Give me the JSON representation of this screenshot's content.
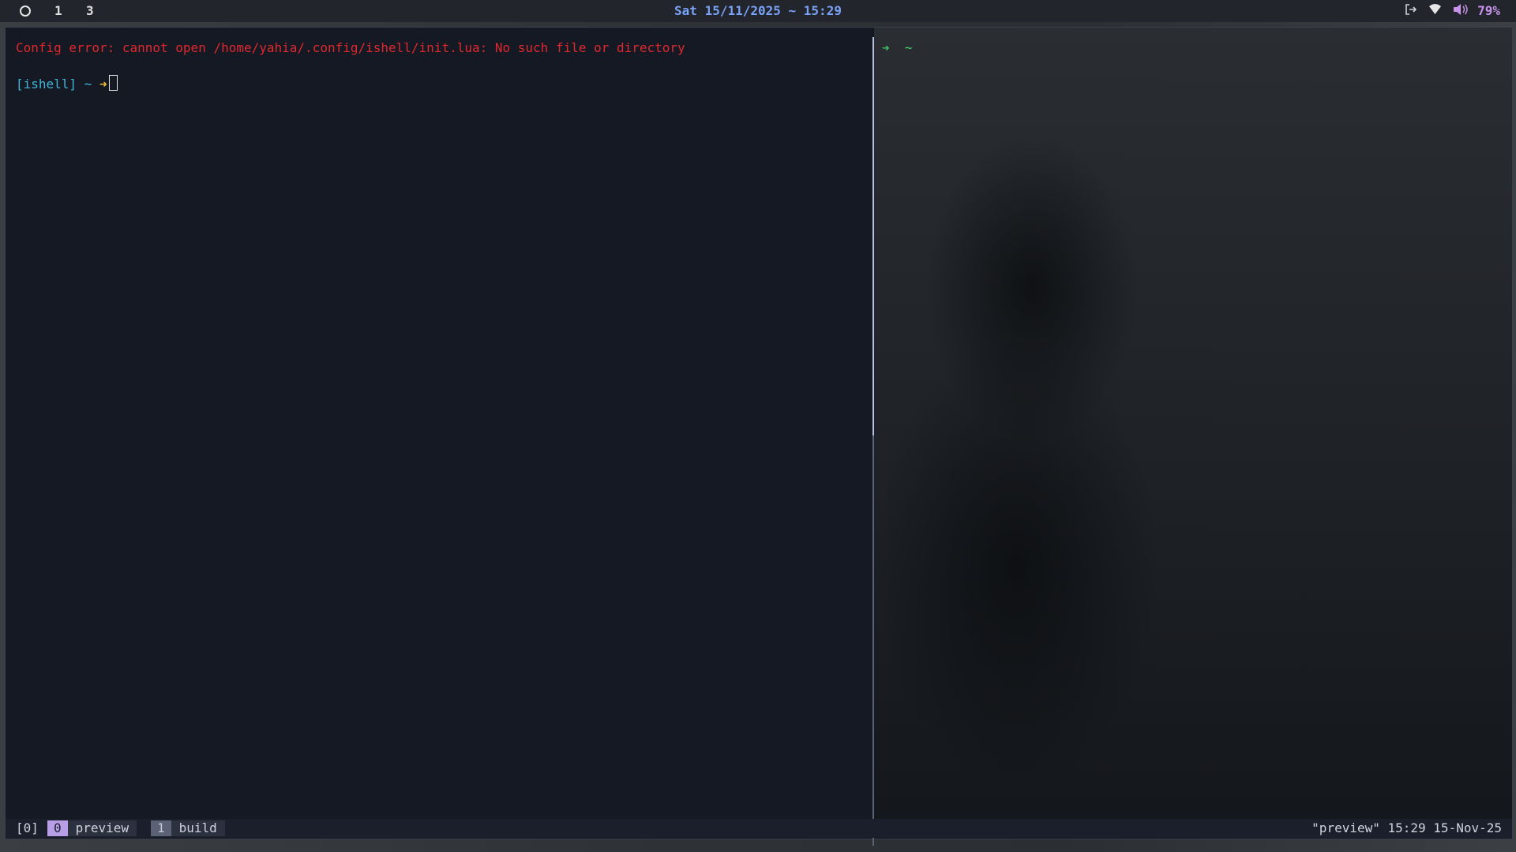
{
  "topbar": {
    "workspaces": [
      "1",
      "3"
    ],
    "clock": "Sat 15/11/2025 ~ 15:29",
    "tray_icons": [
      "logout-icon",
      "wifi-icon",
      "volume-icon"
    ],
    "battery": "79%"
  },
  "terminal": {
    "left_pane": {
      "error_line": "Config error: cannot open /home/yahia/.config/ishell/init.lua: No such file or directory",
      "prompt_tag": "[ishell]",
      "prompt_tilde": "~",
      "prompt_arrow": "➜"
    },
    "right_pane": {
      "prompt_arrow": "➔",
      "prompt_tilde": "~"
    }
  },
  "tmux": {
    "session": "[0]",
    "windows": [
      {
        "index": "0",
        "name": "preview"
      },
      {
        "index": "1",
        "name": "build"
      }
    ],
    "right_status": "\"preview\" 15:29 15-Nov-25"
  },
  "colors": {
    "error": "#e0282e",
    "prompt": "#3fb6d9",
    "arrow": "#f2c12e",
    "right_prompt": "#45d06c",
    "clock": "#7aa2f7",
    "battery": "#c792ea",
    "active_window": "#b79ee6"
  }
}
